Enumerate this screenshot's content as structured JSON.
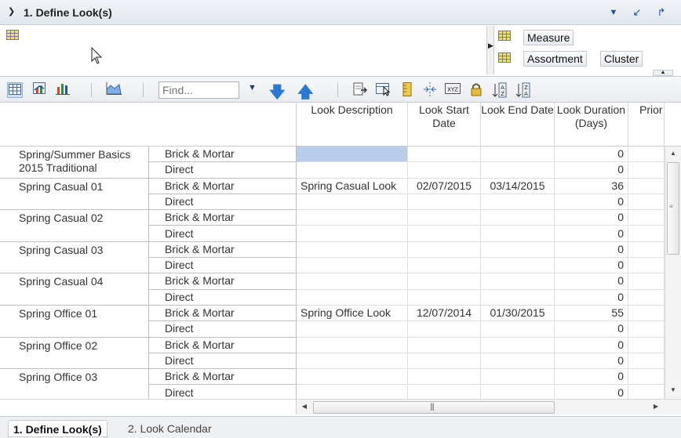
{
  "header": {
    "title": "1. Define Look(s)"
  },
  "right_panel": {
    "measure_label": "Measure",
    "assortment_label": "Assortment",
    "cluster_label": "Cluster"
  },
  "toolbar": {
    "find_placeholder": "Find..."
  },
  "columns": [
    "Look Description",
    "Look Start Date",
    "Look End Date",
    "Look Duration (Days)",
    "Prior"
  ],
  "groups": [
    "Spring/Summer Basics 2015 Traditional",
    "Spring Casual 01",
    "Spring Casual 02",
    "Spring Casual 03",
    "Spring Casual 04",
    "Spring Office 01",
    "Spring Office 02",
    "Spring Office 03"
  ],
  "channels": [
    "Brick & Mortar",
    "Direct"
  ],
  "rows": [
    {
      "desc": "",
      "start": "",
      "end": "",
      "dur": "0"
    },
    {
      "desc": "",
      "start": "",
      "end": "",
      "dur": "0"
    },
    {
      "desc": "Spring Casual Look",
      "start": "02/07/2015",
      "end": "03/14/2015",
      "dur": "36"
    },
    {
      "desc": "",
      "start": "",
      "end": "",
      "dur": "0"
    },
    {
      "desc": "",
      "start": "",
      "end": "",
      "dur": "0"
    },
    {
      "desc": "",
      "start": "",
      "end": "",
      "dur": "0"
    },
    {
      "desc": "",
      "start": "",
      "end": "",
      "dur": "0"
    },
    {
      "desc": "",
      "start": "",
      "end": "",
      "dur": "0"
    },
    {
      "desc": "",
      "start": "",
      "end": "",
      "dur": "0"
    },
    {
      "desc": "",
      "start": "",
      "end": "",
      "dur": "0"
    },
    {
      "desc": "Spring Office Look",
      "start": "12/07/2014",
      "end": "01/30/2015",
      "dur": "55"
    },
    {
      "desc": "",
      "start": "",
      "end": "",
      "dur": "0"
    },
    {
      "desc": "",
      "start": "",
      "end": "",
      "dur": "0"
    },
    {
      "desc": "",
      "start": "",
      "end": "",
      "dur": "0"
    },
    {
      "desc": "",
      "start": "",
      "end": "",
      "dur": "0"
    },
    {
      "desc": "",
      "start": "",
      "end": "",
      "dur": "0"
    }
  ],
  "tabs": [
    "1. Define Look(s)",
    "2. Look Calendar"
  ]
}
